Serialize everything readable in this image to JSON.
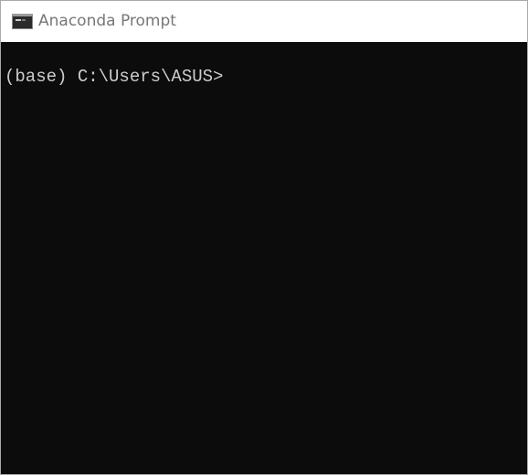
{
  "window": {
    "title": "Anaconda Prompt",
    "icon": "console-icon"
  },
  "console": {
    "prompt": "(base) C:\\Users\\ASUS>",
    "background_color": "#0c0c0c",
    "text_color": "#cccccc"
  }
}
